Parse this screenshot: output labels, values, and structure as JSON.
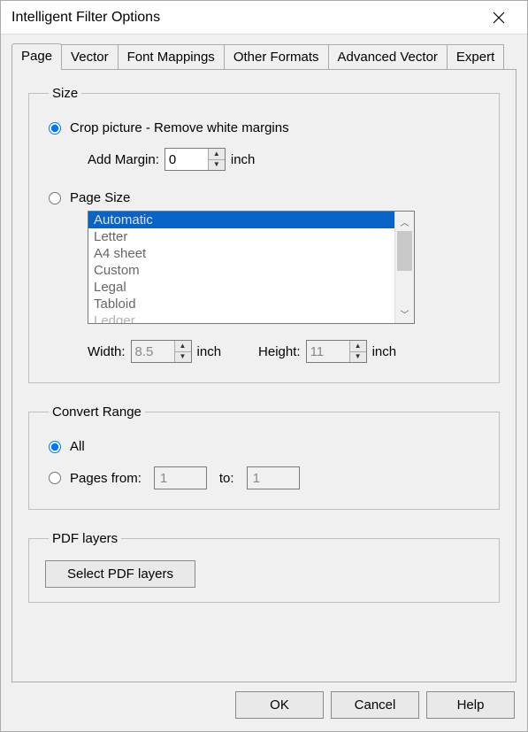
{
  "window": {
    "title": "Intelligent Filter Options"
  },
  "tabs": [
    "Page",
    "Vector",
    "Font Mappings",
    "Other Formats",
    "Advanced Vector",
    "Expert"
  ],
  "selected_tab": 0,
  "size_group": {
    "legend": "Size",
    "crop_label": "Crop picture - Remove white margins",
    "add_margin_label": "Add Margin:",
    "add_margin_value": "0",
    "margin_unit": "inch",
    "page_size_label": "Page Size",
    "page_size_options": [
      "Automatic",
      "Letter",
      "A4 sheet",
      "Custom",
      "Legal",
      "Tabloid",
      "Ledger"
    ],
    "selected_page_size_index": 0,
    "width_label": "Width:",
    "width_value": "8.5",
    "width_unit": "inch",
    "height_label": "Height:",
    "height_value": "11",
    "height_unit": "inch"
  },
  "convert_range": {
    "legend": "Convert Range",
    "all_label": "All",
    "pages_from_label": "Pages from:",
    "from_value": "1",
    "to_label": "to:",
    "to_value": "1"
  },
  "pdf_layers": {
    "legend": "PDF layers",
    "button_label": "Select PDF layers"
  },
  "buttons": {
    "ok": "OK",
    "cancel": "Cancel",
    "help": "Help"
  }
}
